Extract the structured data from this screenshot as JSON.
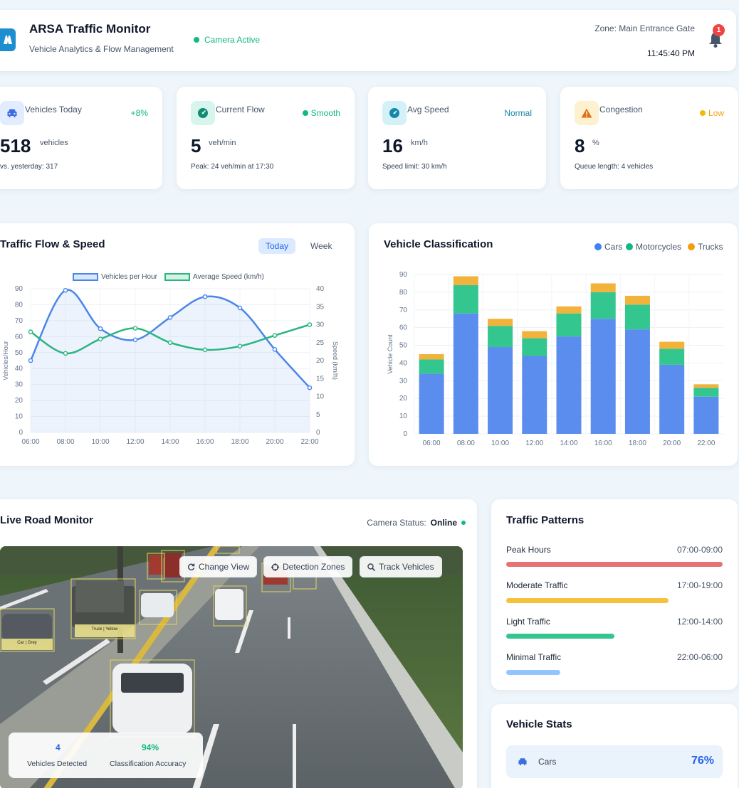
{
  "header": {
    "title": "ARSA Traffic Monitor",
    "subtitle": "Vehicle Analytics & Flow Management",
    "camera_status": "Camera Active",
    "zone": "Zone: Main Entrance Gate",
    "time": "11:45:40 PM",
    "notification_count": "1"
  },
  "stats": {
    "vehicles_today": {
      "label": "Vehicles Today",
      "tag": "+8%",
      "value": "518",
      "unit": "vehicles",
      "note": "vs. yesterday: 317"
    },
    "current_flow": {
      "label": "Current Flow",
      "tag": "Smooth",
      "value": "5",
      "unit": "veh/min",
      "note": "Peak: 24 veh/min at 17:30"
    },
    "avg_speed": {
      "label": "Avg Speed",
      "tag": "Normal",
      "value": "16",
      "unit": "km/h",
      "note": "Speed limit: 30 km/h"
    },
    "congestion": {
      "label": "Congestion",
      "tag": "Low",
      "value": "8",
      "unit": "%",
      "note": "Queue length: 4 vehicles"
    }
  },
  "flow_chart": {
    "title": "Traffic Flow & Speed",
    "tab_today": "Today",
    "tab_week": "Week"
  },
  "class_chart": {
    "title": "Vehicle Classification"
  },
  "chart_data": [
    {
      "type": "line",
      "title": "Traffic Flow & Speed",
      "x": [
        "06:00",
        "08:00",
        "10:00",
        "12:00",
        "14:00",
        "16:00",
        "18:00",
        "20:00",
        "22:00"
      ],
      "series": [
        {
          "name": "Vehicles per Hour",
          "axis": "left",
          "values": [
            45,
            89,
            65,
            58,
            72,
            85,
            78,
            52,
            28
          ]
        },
        {
          "name": "Average Speed (km/h)",
          "axis": "right",
          "values": [
            28,
            22,
            26,
            29,
            25,
            23,
            24,
            27,
            30
          ]
        }
      ],
      "ylabel": "Vehicles/Hour",
      "y2label": "Speed (km/h)",
      "ylim": [
        0,
        90
      ],
      "y2lim": [
        0,
        40
      ],
      "yticks": [
        0,
        10,
        20,
        30,
        40,
        50,
        60,
        70,
        80,
        90
      ],
      "y2ticks": [
        0,
        5,
        10,
        15,
        20,
        25,
        30,
        35,
        40
      ],
      "legend": "top",
      "grid": true
    },
    {
      "type": "bar",
      "stacked": true,
      "title": "Vehicle Classification",
      "categories": [
        "06:00",
        "08:00",
        "10:00",
        "12:00",
        "14:00",
        "16:00",
        "18:00",
        "20:00",
        "22:00"
      ],
      "series": [
        {
          "name": "Cars",
          "color": "#5b8def",
          "values": [
            34,
            68,
            49,
            44,
            55,
            65,
            59,
            39,
            21
          ]
        },
        {
          "name": "Motorcycles",
          "color": "#34c68f",
          "values": [
            8,
            16,
            12,
            10,
            13,
            15,
            14,
            9,
            5
          ]
        },
        {
          "name": "Trucks",
          "color": "#f2b33d",
          "values": [
            3,
            5,
            4,
            4,
            4,
            5,
            5,
            4,
            2
          ]
        }
      ],
      "ylabel": "Vehicle Count",
      "ylim": [
        0,
        90
      ],
      "yticks": [
        0,
        10,
        20,
        30,
        40,
        50,
        60,
        70,
        80,
        90
      ],
      "legend": "top-right",
      "grid": true
    }
  ],
  "live": {
    "title": "Live Road Monitor",
    "status_label": "Camera Status:",
    "status_value": "Online",
    "btn_change_view": "Change View",
    "btn_detection_zones": "Detection Zones",
    "btn_track_vehicles": "Track Vehicles",
    "detected_value": "4",
    "detected_label": "Vehicles Detected",
    "accuracy_value": "94%",
    "accuracy_label": "Classification Accuracy",
    "box_labels": [
      "Truck | Yellow",
      "Car | Grey"
    ]
  },
  "patterns": {
    "title": "Traffic Patterns",
    "items": [
      {
        "name": "Peak Hours",
        "time": "07:00-09:00",
        "level": 1.0,
        "color": "#e57373"
      },
      {
        "name": "Moderate Traffic",
        "time": "17:00-19:00",
        "level": 0.75,
        "color": "#f6c23e"
      },
      {
        "name": "Light Traffic",
        "time": "12:00-14:00",
        "level": 0.5,
        "color": "#34c68f"
      },
      {
        "name": "Minimal Traffic",
        "time": "22:00-06:00",
        "level": 0.25,
        "color": "#93c5fd"
      }
    ]
  },
  "vehicle_stats": {
    "title": "Vehicle Stats",
    "cars_label": "Cars",
    "cars_value": "76%"
  },
  "colors": {
    "accent": "#1d8fd0",
    "success": "#10b981",
    "warning": "#f59e0b",
    "danger": "#ef4444",
    "flow_line": "#4a86e8",
    "speed_line": "#2bb57f"
  }
}
